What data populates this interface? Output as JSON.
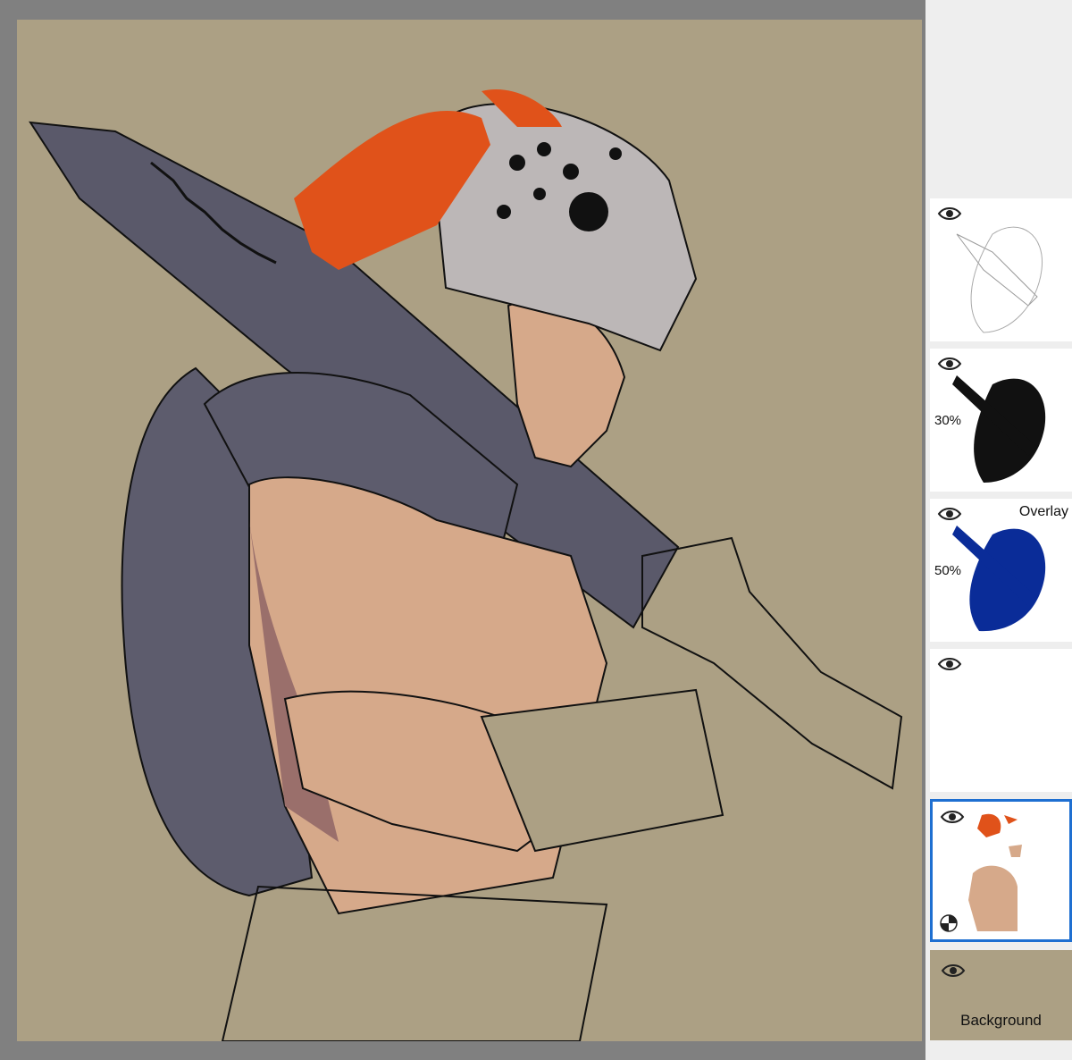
{
  "layers": [
    {
      "id": "line-art",
      "opacity": "",
      "blend": "",
      "visible": true,
      "selected": false
    },
    {
      "id": "shadow",
      "opacity": "30%",
      "blend": "",
      "visible": true,
      "selected": false
    },
    {
      "id": "overlay",
      "opacity": "50%",
      "blend": "Overlay",
      "visible": true,
      "selected": false
    },
    {
      "id": "empty",
      "opacity": "",
      "blend": "",
      "visible": true,
      "selected": false
    },
    {
      "id": "flat-colors",
      "opacity": "",
      "blend": "",
      "visible": true,
      "selected": true
    },
    {
      "id": "background",
      "label": "Background",
      "visible": true,
      "selected": false
    }
  ],
  "colors": {
    "background": "#aca084",
    "selection": "#1e6fd1",
    "fur": "#5d5c6d",
    "skin": "#d6a98a",
    "hair": "#e0521a",
    "overlay_blue": "#0a2c98"
  },
  "icons": {
    "visibility": "eye-icon",
    "alpha_lock": "checker-icon"
  }
}
